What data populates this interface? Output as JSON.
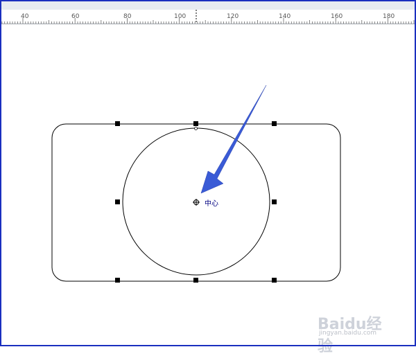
{
  "ruler": {
    "labels": [
      "40",
      "60",
      "80",
      "100",
      "120",
      "140",
      "160",
      "180"
    ]
  },
  "canvas": {
    "center_label": "中心",
    "center_marker_icon": "crosshair-icon",
    "arrow_icon": "pointer-arrow-icon",
    "arrow_color": "#3a5bd6"
  },
  "watermark": {
    "brand": "Baidu经验",
    "url": "jingyan.baidu.com"
  }
}
